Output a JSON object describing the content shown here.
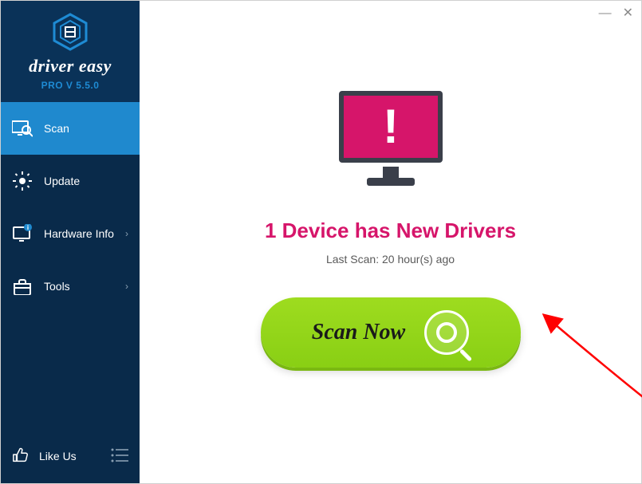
{
  "brand": {
    "name": "driver easy",
    "version": "PRO V 5.5.0"
  },
  "nav": {
    "scan": "Scan",
    "update": "Update",
    "hardware": "Hardware Info",
    "tools": "Tools"
  },
  "footer": {
    "like": "Like Us"
  },
  "main": {
    "status_title": "1 Device has New Drivers",
    "last_scan": "Last Scan: 20 hour(s) ago",
    "scan_button": "Scan Now"
  },
  "colors": {
    "sidebar": "#092a4a",
    "sidebar_brand": "#0a3258",
    "active": "#1f89ce",
    "accent_pink": "#d6156a",
    "accent_green": "#9edc1f"
  }
}
